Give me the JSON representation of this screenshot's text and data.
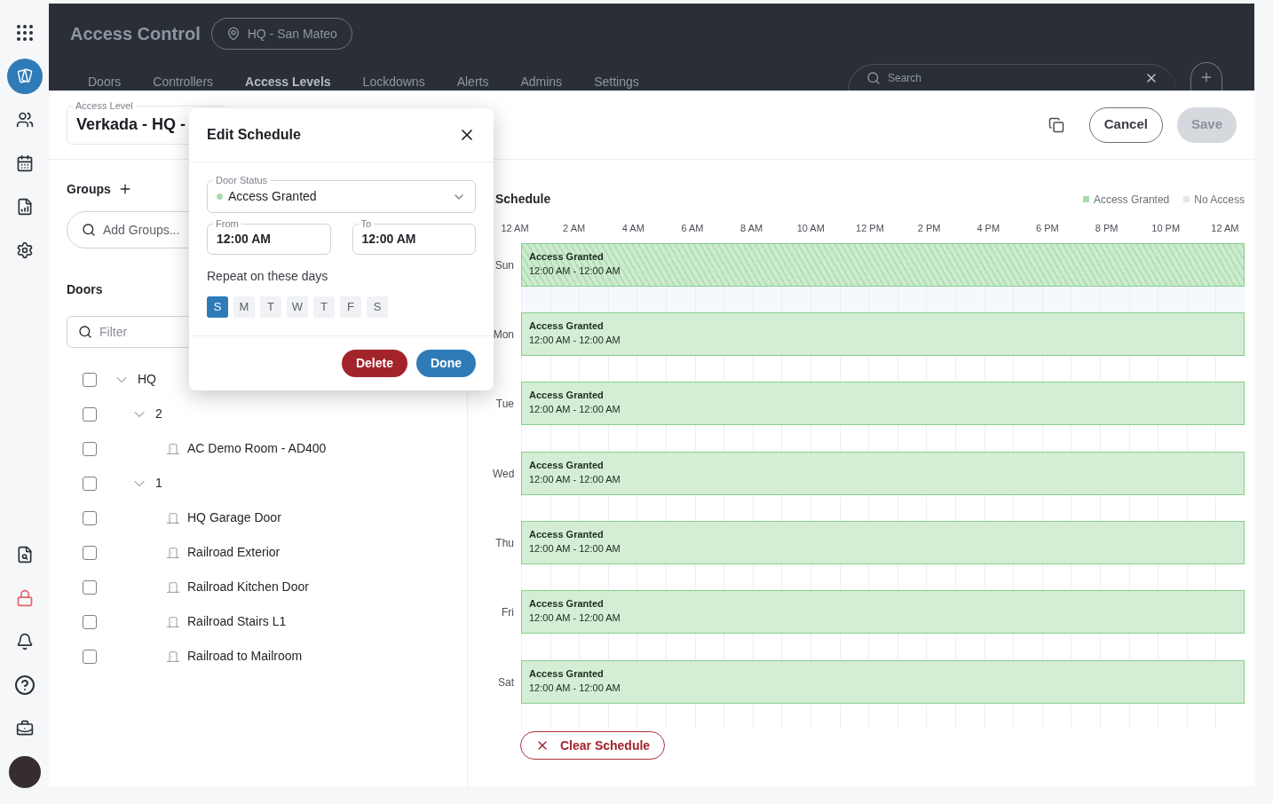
{
  "sidebar": {
    "items": [
      {
        "kind": "apps",
        "selected": false
      },
      {
        "kind": "access",
        "selected": true
      },
      {
        "kind": "users",
        "selected": false
      },
      {
        "kind": "calendar",
        "selected": false
      },
      {
        "kind": "report",
        "selected": false
      },
      {
        "kind": "settings",
        "selected": false
      }
    ],
    "bottom_items": [
      {
        "kind": "debug",
        "selected": false
      },
      {
        "kind": "lock",
        "selected": false
      },
      {
        "kind": "bell",
        "selected": false
      },
      {
        "kind": "help",
        "selected": false
      },
      {
        "kind": "briefcase",
        "selected": false
      },
      {
        "kind": "avatar",
        "selected": false
      }
    ]
  },
  "header": {
    "title": "Access Control",
    "location": "HQ - San Mateo",
    "tabs": [
      {
        "label": "Doors",
        "selected": false
      },
      {
        "label": "Controllers",
        "selected": false
      },
      {
        "label": "Access Levels",
        "selected": true
      },
      {
        "label": "Lockdowns",
        "selected": false
      },
      {
        "label": "Alerts",
        "selected": false
      },
      {
        "label": "Admins",
        "selected": false
      },
      {
        "label": "Settings",
        "selected": false
      }
    ],
    "search": {
      "placeholder": "Search"
    }
  },
  "access_level": {
    "label": "Access Level",
    "value": "Verkada - HQ -"
  },
  "toolbar": {
    "buttons": [
      {
        "label": "Cancel",
        "disabled": false
      },
      {
        "label": "Save",
        "disabled": true
      }
    ]
  },
  "groups": {
    "title": "Groups",
    "search": {
      "placeholder": "Add Groups..."
    }
  },
  "doors": {
    "title": "Doors",
    "filter": {
      "placeholder": "Filter"
    },
    "tree": [
      {
        "label": "HQ",
        "kind": "group",
        "checked": false,
        "expanded": true,
        "children": [
          {
            "label": "2",
            "kind": "group",
            "checked": false,
            "expanded": true,
            "children": [
              {
                "label": "AC Demo Room - AD400",
                "kind": "door",
                "checked": false
              }
            ]
          },
          {
            "label": "1",
            "kind": "group",
            "checked": false,
            "expanded": true,
            "children": [
              {
                "label": "HQ Garage Door",
                "kind": "door",
                "checked": false
              },
              {
                "label": "Railroad Exterior",
                "kind": "door",
                "checked": false
              },
              {
                "label": "Railroad Kitchen Door",
                "kind": "door",
                "checked": false
              },
              {
                "label": "Railroad Stairs L1",
                "kind": "door",
                "checked": false
              },
              {
                "label": "Railroad to Mailroom",
                "kind": "door",
                "checked": false
              }
            ]
          }
        ]
      }
    ]
  },
  "schedule": {
    "title": "Schedule",
    "legend": [
      {
        "label": "Access Granted",
        "color": "#a8dcaf"
      },
      {
        "label": "No Access",
        "color": "#e5e7eb"
      }
    ],
    "hours": [
      "12 AM",
      "2 AM",
      "4 AM",
      "6 AM",
      "8 AM",
      "10 AM",
      "12 PM",
      "2 PM",
      "4 PM",
      "6 PM",
      "8 PM",
      "10 PM",
      "12 AM"
    ],
    "days": [
      {
        "label": "Sun",
        "blocks": [
          {
            "status": "Access Granted",
            "time": "12:00 AM - 12:00 AM",
            "selected": true
          }
        ]
      },
      {
        "label": "Mon",
        "blocks": [
          {
            "status": "Access Granted",
            "time": "12:00 AM - 12:00 AM",
            "selected": false
          }
        ]
      },
      {
        "label": "Tue",
        "blocks": [
          {
            "status": "Access Granted",
            "time": "12:00 AM - 12:00 AM",
            "selected": false
          }
        ]
      },
      {
        "label": "Wed",
        "blocks": [
          {
            "status": "Access Granted",
            "time": "12:00 AM - 12:00 AM",
            "selected": false
          }
        ]
      },
      {
        "label": "Thu",
        "blocks": [
          {
            "status": "Access Granted",
            "time": "12:00 AM - 12:00 AM",
            "selected": false
          }
        ]
      },
      {
        "label": "Fri",
        "blocks": [
          {
            "status": "Access Granted",
            "time": "12:00 AM - 12:00 AM",
            "selected": false
          }
        ]
      },
      {
        "label": "Sat",
        "blocks": [
          {
            "status": "Access Granted",
            "time": "12:00 AM - 12:00 AM",
            "selected": false
          }
        ]
      }
    ],
    "clear_button": "Clear Schedule"
  },
  "dialog": {
    "title": "Edit Schedule",
    "door_status": {
      "label": "Door Status",
      "value": "Access Granted",
      "color": "#a8dcaf"
    },
    "from": {
      "label": "From",
      "value": "12:00 AM"
    },
    "to": {
      "label": "To",
      "value": "12:00 AM"
    },
    "repeat_label": "Repeat on these days",
    "days": [
      {
        "label": "S",
        "selected": true
      },
      {
        "label": "M",
        "selected": false
      },
      {
        "label": "T",
        "selected": false
      },
      {
        "label": "W",
        "selected": false
      },
      {
        "label": "T",
        "selected": false
      },
      {
        "label": "F",
        "selected": false
      },
      {
        "label": "S",
        "selected": false
      }
    ],
    "buttons": [
      {
        "label": "Delete",
        "kind": "danger"
      },
      {
        "label": "Done",
        "kind": "primary"
      }
    ]
  }
}
